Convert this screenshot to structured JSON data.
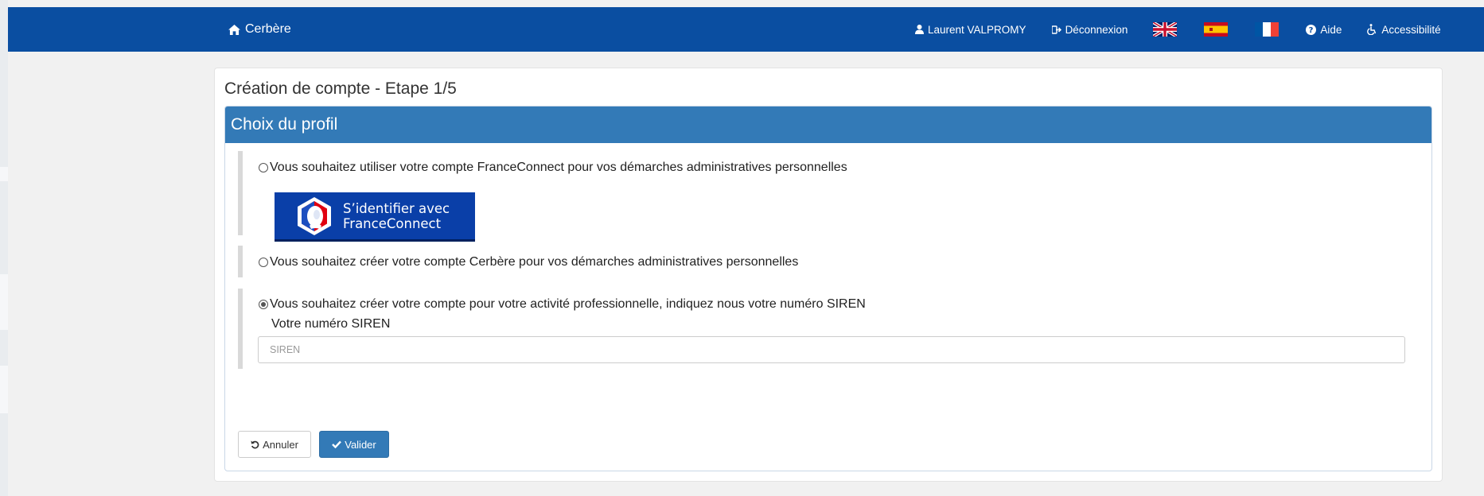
{
  "navbar": {
    "brand": "Cerbère",
    "user": "Laurent VALPROMY",
    "logout": "Déconnexion",
    "help": "Aide",
    "accessibility": "Accessibilité",
    "languages": [
      "english-flag",
      "spanish-flag",
      "french-flag"
    ],
    "color": "#0a4ea1"
  },
  "page": {
    "step_title": "Création de compte - Etape 1/5",
    "section_title": "Choix du profil"
  },
  "choices": {
    "franceconnect": {
      "label": "Vous souhaitez utiliser votre compte FranceConnect pour vos démarches administratives personnelles",
      "checked": false,
      "button_line1": "S’identifier avec",
      "button_line2": "FranceConnect"
    },
    "cerbere": {
      "label": "Vous souhaitez créer votre compte Cerbère pour vos démarches administratives personnelles",
      "checked": false
    },
    "pro": {
      "label": "Vous souhaitez créer votre compte pour votre activité professionnelle, indiquez nous votre numéro SIREN",
      "checked": true,
      "field_label": "Votre numéro SIREN",
      "field_value": "",
      "field_placeholder": "SIREN"
    }
  },
  "actions": {
    "cancel": "Annuler",
    "submit": "Valider",
    "primary_color": "#337ab7"
  }
}
